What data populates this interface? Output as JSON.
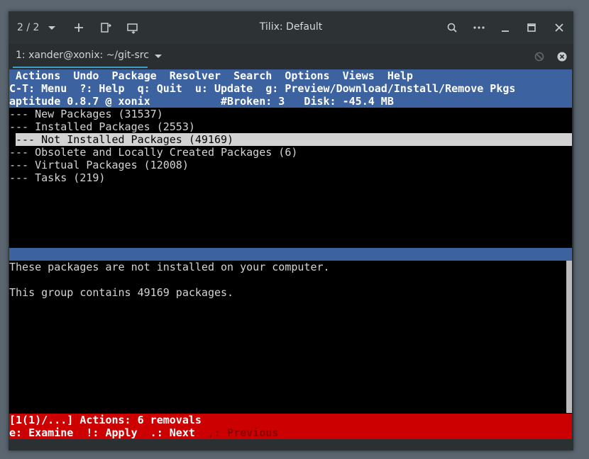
{
  "window": {
    "title": "Tilix: Default",
    "session_counter": "2 / 2"
  },
  "tab": {
    "label": "1: xander@xonix: ~/git-src"
  },
  "aptitude": {
    "menu": [
      " Actions",
      "Undo",
      "Package",
      "Resolver",
      "Search",
      "Options",
      "Views",
      "Help"
    ],
    "help_line": "C-T: Menu  ?: Help  q: Quit  u: Update  g: Preview/Download/Install/Remove Pkgs",
    "status_line": "aptitude 0.8.7 @ xonix           #Broken: 3   Disk: -45.4 MB",
    "packages": [
      "--- New Packages (31537)",
      "--- Installed Packages (2553)",
      "--- Not Installed Packages (49169)",
      "--- Obsolete and Locally Created Packages (6)",
      "--- Virtual Packages (12008)",
      "--- Tasks (219)"
    ],
    "selected_index": 2,
    "description": [
      "These packages are not installed on your computer.",
      "",
      "This group contains 49169 packages."
    ],
    "actions_line": "[1(1)/...] Actions: 6 removals",
    "keys_line": "e: Examine  !: Apply  .: Next  ",
    "keys_prev": ",: Previous"
  }
}
